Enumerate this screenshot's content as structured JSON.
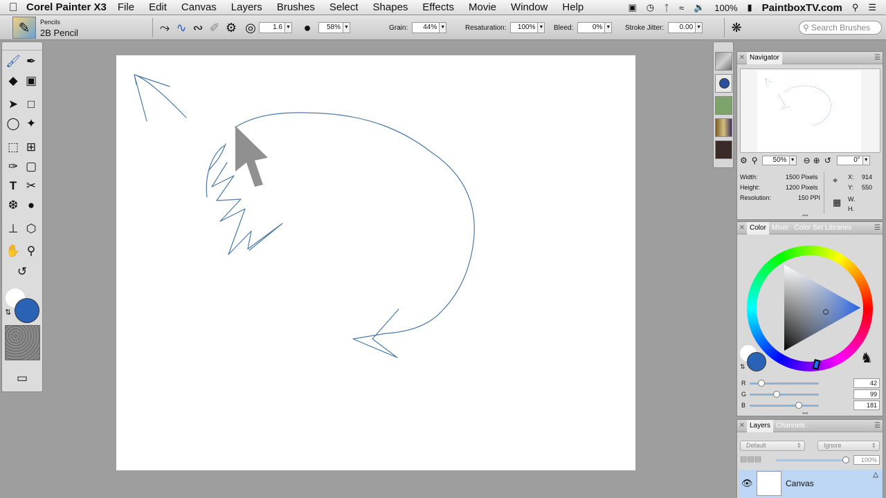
{
  "menubar": {
    "app_name": "Corel Painter X3",
    "items": [
      "File",
      "Edit",
      "Canvas",
      "Layers",
      "Brushes",
      "Select",
      "Shapes",
      "Effects",
      "Movie",
      "Window",
      "Help"
    ],
    "battery": "100%",
    "site": "PaintboxTV.com"
  },
  "propbar": {
    "brush_category": "Pencils",
    "brush_variant": "2B Pencil",
    "size": "1.6",
    "opacity": "58%",
    "grain_label": "Grain:",
    "grain": "44%",
    "resaturation_label": "Resaturation:",
    "resaturation": "100%",
    "bleed_label": "Bleed:",
    "bleed": "0%",
    "jitter_label": "Stroke Jitter:",
    "jitter": "0.00",
    "search_placeholder": "Search Brushes"
  },
  "navigator": {
    "tab": "Navigator",
    "zoom": "50%",
    "rotation": "0°",
    "width_label": "Width:",
    "width": "1500 Pixels",
    "height_label": "Height:",
    "height": "1200 Pixels",
    "resolution_label": "Resolution:",
    "resolution": "150 PPI",
    "x_label": "X:",
    "x_value": "914",
    "y_label": "Y:",
    "y_value": "550",
    "w_label": "W.",
    "h_label": "H."
  },
  "color_panel": {
    "tabs": [
      "Color",
      "Mixer",
      "Color Set Libraries"
    ],
    "r_label": "R",
    "g_label": "G",
    "b_label": "B",
    "r": "42",
    "g": "99",
    "b": "181",
    "r_fraction": 0.165,
    "g_fraction": 0.388,
    "b_fraction": 0.71,
    "main_color": "#2a63b5",
    "secondary_color": "#ffffff"
  },
  "layers": {
    "tabs": [
      "Layers",
      "Channels"
    ],
    "composite_method": "Default",
    "preserve": "Ignore",
    "opacity": "100%",
    "layer_name": "Canvas"
  },
  "colors": {
    "stroke": "#4a7aa8",
    "canvas": "#ffffff"
  }
}
